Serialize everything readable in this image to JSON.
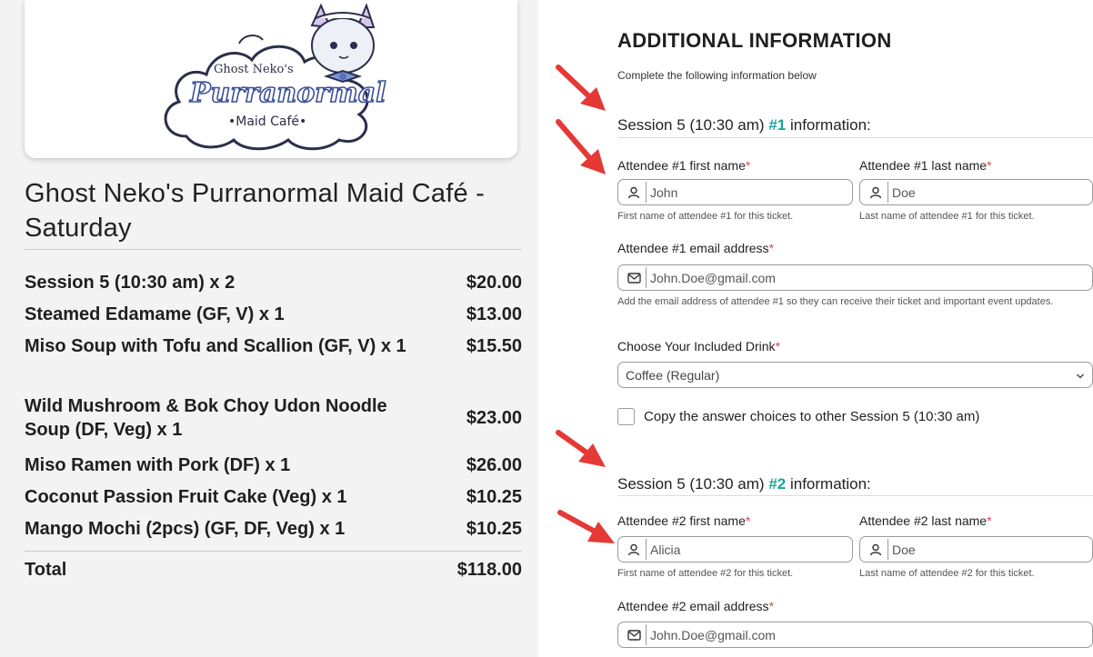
{
  "logo": {
    "line1": "Ghost Neko's",
    "line2": "Purranormal",
    "line3": "•Maid Café•"
  },
  "order": {
    "event_title": "Ghost Neko's Purranormal Maid Café - Saturday",
    "items": [
      {
        "name": "Session 5 (10:30 am) x 2",
        "price": "$20.00"
      },
      {
        "name": "Steamed Edamame (GF, V) x 1",
        "price": "$13.00"
      },
      {
        "name": "Miso Soup with Tofu and Scallion (GF, V) x 1",
        "price": "$15.50"
      },
      {
        "name": "Wild Mushroom & Bok Choy Udon Noodle Soup (DF, Veg) x 1",
        "price": "$23.00"
      },
      {
        "name": "Miso Ramen with Pork (DF) x 1",
        "price": "$26.00"
      },
      {
        "name": "Coconut Passion Fruit Cake (Veg)  x 1",
        "price": "$10.25"
      },
      {
        "name": "Mango Mochi (2pcs) (GF, DF, Veg) x 1",
        "price": "$10.25"
      }
    ],
    "total_label": "Total",
    "total_value": "$118.00"
  },
  "form": {
    "heading": "ADDITIONAL INFORMATION",
    "subheading": "Complete the following information below",
    "required_mark": "*",
    "attendee1": {
      "session_prefix": "Session 5 (10:30 am) ",
      "number": "#1",
      "session_suffix": " information:",
      "first_name_label": "Attendee #1 first name",
      "first_name_value": "John",
      "first_name_hint": "First name of attendee #1 for this ticket.",
      "last_name_label": "Attendee #1 last name",
      "last_name_value": "Doe",
      "last_name_hint": "Last name of attendee #1 for this ticket.",
      "email_label": "Attendee #1 email address",
      "email_value": "John.Doe@gmail.com",
      "email_hint": "Add the email address of attendee #1 so they can receive their ticket and important event updates.",
      "drink_label": "Choose Your Included Drink",
      "drink_value": "Coffee (Regular)",
      "copy_label": "Copy the answer choices to other Session 5 (10:30 am)"
    },
    "attendee2": {
      "session_prefix": "Session 5 (10:30 am) ",
      "number": "#2",
      "session_suffix": " information:",
      "first_name_label": "Attendee #2 first name",
      "first_name_value": "Alicia",
      "first_name_hint": "First name of attendee #2 for this ticket.",
      "last_name_label": "Attendee #2 last name",
      "last_name_value": "Doe",
      "last_name_hint": "Last name of attendee #2 for this ticket.",
      "email_label": "Attendee #2 email address",
      "email_value": "John.Doe@gmail.com"
    }
  },
  "colors": {
    "accent_teal": "#1aa59a",
    "required_red": "#e0434f",
    "arrow_red": "#e53935"
  },
  "icons": {
    "person": "person-icon",
    "envelope": "envelope-icon",
    "chevron": "chevron-down-icon",
    "arrow": "red-arrow-icon"
  }
}
